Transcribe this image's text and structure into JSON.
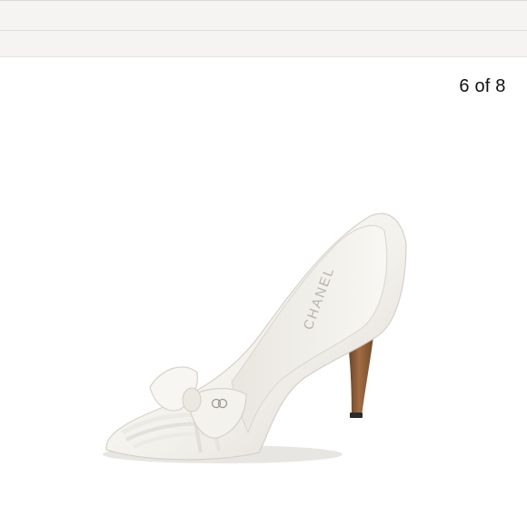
{
  "gallery": {
    "counter_label": "6 of 8",
    "current_index": 6,
    "total_images": 8
  },
  "product_image": {
    "icon": "white-peep-toe-pump-with-bow-photo",
    "logo_text": "CHANEL"
  },
  "colors": {
    "toolbar_bg": "#f5f4f2",
    "shoe_leather": "#f4f2ee",
    "heel_wood": "#8a5a36",
    "counter_text": "#111111"
  }
}
